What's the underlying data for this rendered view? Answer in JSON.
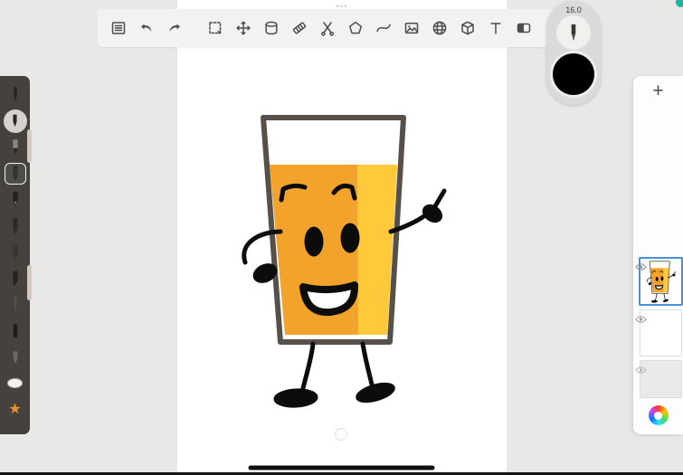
{
  "app": {
    "name": "sketch-drawing-app"
  },
  "icons": {
    "star": "★"
  },
  "top_toolbar": {
    "tools": [
      "layer-list",
      "undo",
      "redo",
      "select-marquee",
      "move-transform",
      "fill-can",
      "hatch-eraser",
      "cutter",
      "polygon-shape",
      "curve",
      "import-image",
      "sphere-grid",
      "perspective-cube",
      "text",
      "gradient"
    ]
  },
  "brush_hud": {
    "size_label": "16.0",
    "color": "#000000"
  },
  "left_toolbar": {
    "tools": [
      "fineliner",
      "active-tool-puck",
      "pencil",
      "watercolor-brush",
      "fountain-pen",
      "felt-pen",
      "paint-brush",
      "marker",
      "graphite-pencil",
      "charcoal",
      "airbrush",
      "eraser",
      "favorites-star"
    ]
  },
  "layers_panel": {
    "add_button": "+",
    "layers": [
      {
        "selected": true,
        "visible": true,
        "content": "orange-juice-character"
      },
      {
        "selected": false,
        "visible": true,
        "content": "empty"
      },
      {
        "selected": false,
        "visible": true,
        "content": "background"
      }
    ]
  },
  "canvas": {
    "handle_dots": "⋯",
    "artwork": {
      "subject": "cartoon glass of orange juice character with face, arms and legs",
      "glass_outline": "#57504a",
      "juice_left": "#f2a32b",
      "juice_right": "#ffc93c",
      "ink": "#0c0c0c"
    }
  },
  "colors": {
    "selection_blue": "#4a90d9",
    "sidebar_bg": "#45423d",
    "toolbar_bg": "#f3f2f0"
  }
}
